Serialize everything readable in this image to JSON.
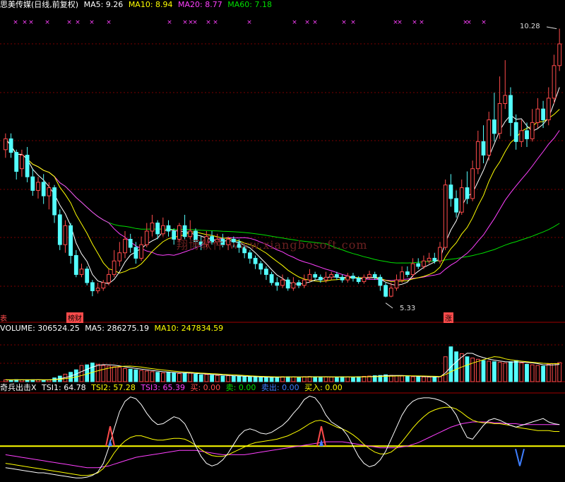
{
  "price_header": {
    "stock_name": "思美传媒(日线,前复权)",
    "ma5": "MA5: 9.26",
    "ma10": "MA10: 8.94",
    "ma20": "MA20: 8.77",
    "ma60": "MA60: 7.18"
  },
  "volume_header": {
    "volume": "VOLUME: 306524.25",
    "ma5": "MA5: 286275.19",
    "ma10": "MA10: 247834.59"
  },
  "indicator_header": {
    "name": "奇兵出击X",
    "tsi1": "TSI1: 64.78",
    "tsi2": "TSI2: 57.28",
    "tsi3": "TSI3: 65.39",
    "buy": "买: 0.00",
    "sell": "卖: 0.00",
    "sell_out": "卖出: 0.00",
    "buy_in": "买入: 0.00"
  },
  "annotations": {
    "high_price": "10.28",
    "low_price": "5.33",
    "tag_left": "榜财",
    "tag_right": "涨",
    "tag_edge": "表"
  },
  "watermark": "翔博软件 www.xiangbosoft.com",
  "colors": {
    "up": "#ff4b4b",
    "down": "#54ffff",
    "ma5": "#ffffff",
    "ma10": "#ffff00",
    "ma20": "#ff40ff",
    "ma60": "#00e000",
    "grid": "#7a0000",
    "signal_line": "#ffff00"
  },
  "chart_data": {
    "type": "candlestick",
    "price_range": [
      5.0,
      10.6
    ],
    "candles": [
      {
        "o": 8.05,
        "c": 8.25,
        "h": 8.35,
        "l": 7.9
      },
      {
        "o": 8.25,
        "c": 8.0,
        "h": 8.35,
        "l": 7.9
      },
      {
        "o": 8.0,
        "c": 7.65,
        "h": 8.05,
        "l": 7.5
      },
      {
        "o": 7.7,
        "c": 7.95,
        "h": 8.05,
        "l": 7.55
      },
      {
        "o": 7.95,
        "c": 7.55,
        "h": 8.1,
        "l": 7.45
      },
      {
        "o": 7.55,
        "c": 7.3,
        "h": 7.7,
        "l": 7.2
      },
      {
        "o": 7.3,
        "c": 7.45,
        "h": 7.55,
        "l": 7.15
      },
      {
        "o": 7.45,
        "c": 7.2,
        "h": 7.6,
        "l": 7.05
      },
      {
        "o": 7.2,
        "c": 7.35,
        "h": 7.45,
        "l": 6.95
      },
      {
        "o": 7.35,
        "c": 6.85,
        "h": 7.4,
        "l": 6.7
      },
      {
        "o": 6.85,
        "c": 6.3,
        "h": 6.95,
        "l": 6.2
      },
      {
        "o": 6.3,
        "c": 6.65,
        "h": 6.75,
        "l": 6.15
      },
      {
        "o": 6.65,
        "c": 6.1,
        "h": 6.7,
        "l": 5.95
      },
      {
        "o": 6.1,
        "c": 5.75,
        "h": 6.2,
        "l": 5.7
      },
      {
        "o": 5.75,
        "c": 5.85,
        "h": 5.95,
        "l": 5.7
      },
      {
        "o": 5.85,
        "c": 5.6,
        "h": 5.9,
        "l": 5.55
      },
      {
        "o": 5.6,
        "c": 5.45,
        "h": 5.65,
        "l": 5.35
      },
      {
        "o": 5.45,
        "c": 5.5,
        "h": 5.6,
        "l": 5.4
      },
      {
        "o": 5.5,
        "c": 5.6,
        "h": 5.65,
        "l": 5.45
      },
      {
        "o": 5.6,
        "c": 5.75,
        "h": 5.85,
        "l": 5.55
      },
      {
        "o": 5.75,
        "c": 6.0,
        "h": 6.2,
        "l": 5.7
      },
      {
        "o": 6.0,
        "c": 6.15,
        "h": 6.35,
        "l": 5.9
      },
      {
        "o": 6.15,
        "c": 6.4,
        "h": 6.55,
        "l": 6.05
      },
      {
        "o": 6.4,
        "c": 6.25,
        "h": 6.5,
        "l": 6.15
      },
      {
        "o": 6.25,
        "c": 6.05,
        "h": 6.35,
        "l": 5.95
      },
      {
        "o": 6.05,
        "c": 6.3,
        "h": 6.45,
        "l": 6.0
      },
      {
        "o": 6.3,
        "c": 6.55,
        "h": 6.7,
        "l": 6.25
      },
      {
        "o": 6.55,
        "c": 6.7,
        "h": 6.85,
        "l": 6.45
      },
      {
        "o": 6.7,
        "c": 6.5,
        "h": 6.75,
        "l": 6.4
      },
      {
        "o": 6.5,
        "c": 6.65,
        "h": 6.8,
        "l": 6.45
      },
      {
        "o": 6.65,
        "c": 6.55,
        "h": 6.75,
        "l": 6.45
      },
      {
        "o": 6.55,
        "c": 6.4,
        "h": 6.6,
        "l": 6.3
      },
      {
        "o": 6.4,
        "c": 6.65,
        "h": 6.7,
        "l": 6.35
      },
      {
        "o": 6.65,
        "c": 6.45,
        "h": 6.85,
        "l": 6.4
      },
      {
        "o": 6.45,
        "c": 6.55,
        "h": 6.75,
        "l": 6.4
      },
      {
        "o": 6.55,
        "c": 6.35,
        "h": 6.6,
        "l": 6.25
      },
      {
        "o": 6.35,
        "c": 6.3,
        "h": 6.45,
        "l": 6.2
      },
      {
        "o": 6.3,
        "c": 6.45,
        "h": 6.55,
        "l": 6.25
      },
      {
        "o": 6.45,
        "c": 6.35,
        "h": 6.55,
        "l": 6.3
      },
      {
        "o": 6.35,
        "c": 6.4,
        "h": 6.5,
        "l": 6.3
      },
      {
        "o": 6.4,
        "c": 6.3,
        "h": 6.5,
        "l": 6.25
      },
      {
        "o": 6.3,
        "c": 6.4,
        "h": 6.45,
        "l": 6.2
      },
      {
        "o": 6.4,
        "c": 6.35,
        "h": 6.45,
        "l": 6.25
      },
      {
        "o": 6.35,
        "c": 6.25,
        "h": 6.4,
        "l": 6.15
      },
      {
        "o": 6.25,
        "c": 6.15,
        "h": 6.3,
        "l": 6.05
      },
      {
        "o": 6.15,
        "c": 6.05,
        "h": 6.2,
        "l": 5.95
      },
      {
        "o": 6.05,
        "c": 5.95,
        "h": 6.1,
        "l": 5.85
      },
      {
        "o": 5.95,
        "c": 5.85,
        "h": 6.0,
        "l": 5.75
      },
      {
        "o": 5.85,
        "c": 5.75,
        "h": 5.9,
        "l": 5.65
      },
      {
        "o": 5.75,
        "c": 5.6,
        "h": 5.8,
        "l": 5.55
      },
      {
        "o": 5.6,
        "c": 5.55,
        "h": 5.7,
        "l": 5.45
      },
      {
        "o": 5.55,
        "c": 5.65,
        "h": 5.75,
        "l": 5.5
      },
      {
        "o": 5.65,
        "c": 5.5,
        "h": 5.7,
        "l": 5.45
      },
      {
        "o": 5.5,
        "c": 5.6,
        "h": 5.7,
        "l": 5.45
      },
      {
        "o": 5.6,
        "c": 5.55,
        "h": 5.65,
        "l": 5.5
      },
      {
        "o": 5.55,
        "c": 5.65,
        "h": 5.75,
        "l": 5.5
      },
      {
        "o": 5.65,
        "c": 5.75,
        "h": 5.85,
        "l": 5.6
      },
      {
        "o": 5.75,
        "c": 5.7,
        "h": 5.8,
        "l": 5.65
      },
      {
        "o": 5.7,
        "c": 5.65,
        "h": 5.75,
        "l": 5.6
      },
      {
        "o": 5.65,
        "c": 5.7,
        "h": 5.8,
        "l": 5.6
      },
      {
        "o": 5.7,
        "c": 5.75,
        "h": 5.8,
        "l": 5.65
      },
      {
        "o": 5.75,
        "c": 5.7,
        "h": 5.8,
        "l": 5.65
      },
      {
        "o": 5.7,
        "c": 5.65,
        "h": 5.75,
        "l": 5.6
      },
      {
        "o": 5.65,
        "c": 5.72,
        "h": 5.78,
        "l": 5.6
      },
      {
        "o": 5.72,
        "c": 5.68,
        "h": 5.78,
        "l": 5.62
      },
      {
        "o": 5.68,
        "c": 5.62,
        "h": 5.72,
        "l": 5.58
      },
      {
        "o": 5.62,
        "c": 5.7,
        "h": 5.75,
        "l": 5.58
      },
      {
        "o": 5.7,
        "c": 5.75,
        "h": 5.82,
        "l": 5.65
      },
      {
        "o": 5.75,
        "c": 5.7,
        "h": 5.8,
        "l": 5.65
      },
      {
        "o": 5.7,
        "c": 5.55,
        "h": 5.75,
        "l": 5.45
      },
      {
        "o": 5.55,
        "c": 5.35,
        "h": 5.6,
        "l": 5.33
      },
      {
        "o": 5.35,
        "c": 5.5,
        "h": 5.6,
        "l": 5.33
      },
      {
        "o": 5.5,
        "c": 5.65,
        "h": 5.75,
        "l": 5.45
      },
      {
        "o": 5.65,
        "c": 5.8,
        "h": 5.9,
        "l": 5.6
      },
      {
        "o": 5.8,
        "c": 5.75,
        "h": 5.9,
        "l": 5.7
      },
      {
        "o": 5.75,
        "c": 5.95,
        "h": 6.05,
        "l": 5.7
      },
      {
        "o": 5.95,
        "c": 5.9,
        "h": 6.05,
        "l": 5.85
      },
      {
        "o": 5.9,
        "c": 6.0,
        "h": 6.1,
        "l": 5.85
      },
      {
        "o": 6.0,
        "c": 6.05,
        "h": 6.15,
        "l": 5.95
      },
      {
        "o": 6.05,
        "c": 6.0,
        "h": 6.15,
        "l": 5.95
      },
      {
        "o": 6.0,
        "c": 6.25,
        "h": 6.35,
        "l": 5.95
      },
      {
        "o": 6.25,
        "c": 7.4,
        "h": 7.5,
        "l": 6.2
      },
      {
        "o": 7.4,
        "c": 7.15,
        "h": 7.6,
        "l": 7.0
      },
      {
        "o": 7.15,
        "c": 6.9,
        "h": 7.3,
        "l": 6.8
      },
      {
        "o": 6.9,
        "c": 7.35,
        "h": 7.5,
        "l": 6.85
      },
      {
        "o": 7.35,
        "c": 7.15,
        "h": 7.65,
        "l": 7.05
      },
      {
        "o": 7.15,
        "c": 7.7,
        "h": 7.85,
        "l": 7.1
      },
      {
        "o": 7.7,
        "c": 8.2,
        "h": 8.4,
        "l": 7.6
      },
      {
        "o": 8.2,
        "c": 7.95,
        "h": 8.5,
        "l": 7.8
      },
      {
        "o": 7.95,
        "c": 8.6,
        "h": 8.75,
        "l": 7.85
      },
      {
        "o": 8.6,
        "c": 8.35,
        "h": 9.1,
        "l": 8.2
      },
      {
        "o": 8.35,
        "c": 8.9,
        "h": 9.4,
        "l": 8.25
      },
      {
        "o": 8.9,
        "c": 9.05,
        "h": 9.7,
        "l": 8.8
      },
      {
        "o": 9.05,
        "c": 8.55,
        "h": 9.2,
        "l": 8.3
      },
      {
        "o": 8.55,
        "c": 8.2,
        "h": 8.7,
        "l": 8.05
      },
      {
        "o": 8.2,
        "c": 8.4,
        "h": 8.6,
        "l": 8.1
      },
      {
        "o": 8.4,
        "c": 8.25,
        "h": 8.55,
        "l": 8.1
      },
      {
        "o": 8.25,
        "c": 8.55,
        "h": 8.8,
        "l": 8.2
      },
      {
        "o": 8.55,
        "c": 8.8,
        "h": 9.0,
        "l": 8.45
      },
      {
        "o": 8.8,
        "c": 8.6,
        "h": 8.95,
        "l": 8.45
      },
      {
        "o": 8.6,
        "c": 9.0,
        "h": 9.2,
        "l": 8.5
      },
      {
        "o": 9.0,
        "c": 9.6,
        "h": 9.8,
        "l": 8.9
      },
      {
        "o": 9.6,
        "c": 10.0,
        "h": 10.28,
        "l": 9.5
      }
    ],
    "volume_range": [
      0,
      750000
    ],
    "volumes": [
      30000,
      28000,
      32000,
      30000,
      29000,
      31000,
      30000,
      28000,
      27000,
      60000,
      90000,
      120000,
      150000,
      190000,
      260000,
      270000,
      300000,
      280000,
      260000,
      250000,
      240000,
      230000,
      210000,
      200000,
      190000,
      180000,
      170000,
      160000,
      150000,
      140000,
      150000,
      140000,
      130000,
      140000,
      135000,
      120000,
      110000,
      115000,
      105000,
      100000,
      90000,
      95000,
      88000,
      85000,
      80000,
      75000,
      70000,
      68000,
      72000,
      70000,
      75000,
      80000,
      78000,
      76000,
      74000,
      80000,
      82000,
      78000,
      76000,
      74000,
      72000,
      75000,
      78000,
      76000,
      74000,
      80000,
      85000,
      90000,
      95000,
      100000,
      110000,
      100000,
      95000,
      90000,
      85000,
      80000,
      78000,
      76000,
      74000,
      72000,
      80000,
      400000,
      560000,
      480000,
      450000,
      400000,
      380000,
      360000,
      340000,
      330000,
      320000,
      310000,
      300000,
      320000,
      340000,
      300000,
      280000,
      270000,
      260000,
      250000,
      280000,
      290000,
      306524
    ],
    "indicator_range": [
      0,
      100
    ],
    "tsi1": [
      15,
      14,
      13,
      12,
      11,
      10,
      9,
      9,
      8,
      7,
      6,
      5,
      4,
      3,
      3,
      4,
      6,
      10,
      20,
      38,
      60,
      80,
      92,
      97,
      95,
      88,
      78,
      70,
      65,
      66,
      70,
      74,
      72,
      66,
      54,
      40,
      28,
      20,
      17,
      19,
      24,
      32,
      42,
      52,
      58,
      60,
      58,
      55,
      54,
      56,
      60,
      64,
      70,
      78,
      85,
      94,
      98,
      96,
      88,
      76,
      68,
      64,
      60,
      52,
      40,
      28,
      20,
      16,
      18,
      24,
      34,
      48,
      62,
      76,
      86,
      92,
      95,
      96,
      96,
      95,
      93,
      90,
      85,
      76,
      62,
      50,
      48,
      56,
      64,
      70,
      72,
      70,
      67,
      64,
      62,
      64,
      66,
      68,
      70,
      72,
      68,
      66,
      65
    ],
    "tsi2": [
      20,
      19,
      18,
      17,
      16,
      15,
      14,
      13,
      12,
      11,
      10,
      9,
      8,
      7,
      6,
      6,
      7,
      9,
      14,
      22,
      32,
      40,
      46,
      50,
      52,
      52,
      50,
      48,
      47,
      47,
      48,
      49,
      49,
      48,
      45,
      41,
      36,
      32,
      29,
      28,
      28,
      30,
      33,
      36,
      39,
      42,
      44,
      45,
      46,
      47,
      48,
      50,
      52,
      55,
      58,
      62,
      66,
      69,
      70,
      68,
      65,
      62,
      60,
      57,
      53,
      48,
      42,
      37,
      33,
      31,
      31,
      33,
      38,
      45,
      53,
      61,
      68,
      74,
      79,
      82,
      84,
      85,
      85,
      83,
      79,
      74,
      70,
      68,
      67,
      67,
      66,
      66,
      65,
      64,
      62,
      61,
      60,
      59,
      58,
      58,
      58,
      57,
      57
    ],
    "tsi3": [
      30,
      29,
      28,
      27,
      26,
      25,
      24,
      23,
      22,
      21,
      20,
      19,
      18,
      17,
      16,
      15,
      15,
      15,
      16,
      17,
      19,
      21,
      23,
      25,
      27,
      28,
      29,
      30,
      31,
      32,
      33,
      34,
      35,
      35,
      35,
      35,
      34,
      33,
      32,
      31,
      30,
      30,
      30,
      30,
      30,
      31,
      32,
      33,
      34,
      35,
      36,
      37,
      38,
      39,
      40,
      41,
      42,
      43,
      44,
      45,
      45,
      45,
      45,
      44,
      43,
      42,
      41,
      40,
      39,
      38,
      38,
      38,
      38,
      39,
      40,
      42,
      44,
      47,
      50,
      53,
      56,
      59,
      62,
      64,
      66,
      67,
      68,
      68,
      68,
      68,
      67,
      67,
      66,
      66,
      66,
      65,
      65,
      65,
      65,
      65,
      65,
      65,
      65
    ],
    "signal_level": 40
  }
}
